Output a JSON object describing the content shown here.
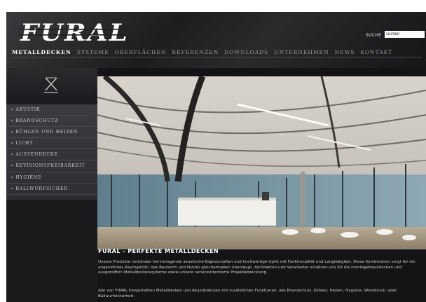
{
  "header": {
    "logo_text": "FURAL",
    "search_label": "SUCHE",
    "search_value": "suchen"
  },
  "nav": {
    "items": [
      "METALLDECKEN",
      "SYSTEME",
      "OBERFLÄCHEN",
      "REFERENZEN",
      "DOWNLOADS",
      "UNTERNEHMEN",
      "NEWS",
      "KONTAKT"
    ],
    "active_index": 0
  },
  "sidebar": {
    "emblem_icon": "metal-ceiling-emblem-icon",
    "menu_items": [
      "» AKUSTIK",
      "» BRANDSCHUTZ",
      "» KÜHLEN UND HEIZEN",
      "» LICHT",
      "» AUSSENDECKE",
      "» REVISIONSFREIBARKEIT",
      "» HYGIENE",
      "» BALLWURFSICHER"
    ]
  },
  "content": {
    "title": "FURAL - PERFEKTE METALLDECKEN",
    "paragraphs": [
      "Unsere Produkte verbinden hervorragende akustische Eigenschaften und hochwertige Optik mit Funktionalität und Langlebigkeit. Diese Kombination sorgt für ein angenehmes Raumgefühl, das Bauherrn und Nutzer gleichermaßen überzeugt. Architekten und Verarbeiter schätzen uns für die montagefreundlichen und ausgereiften Metalldeckensysteme sowie unsere serviceorientierte Projektabwicklung.",
      "Alle von FURAL hergestellten Metalldecken und Akustikdecken mit zusätzlichen Funktionen, wie Brandschutz, Kühlen, Heizen, Hygiene, Winddruck- oder Ballwurfsicherheit."
    ]
  },
  "colors": {
    "background": "#141416",
    "sidebar_menu": "#35353a",
    "text_light": "#cfcfcf",
    "accent_white": "#ffffff"
  }
}
